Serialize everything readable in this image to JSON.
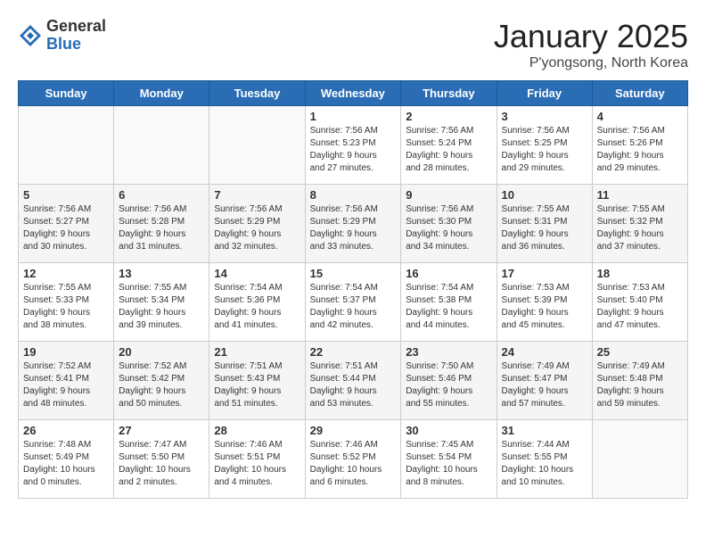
{
  "header": {
    "logo_general": "General",
    "logo_blue": "Blue",
    "month_title": "January 2025",
    "location": "P'yongsong, North Korea"
  },
  "weekdays": [
    "Sunday",
    "Monday",
    "Tuesday",
    "Wednesday",
    "Thursday",
    "Friday",
    "Saturday"
  ],
  "weeks": [
    [
      {
        "day": "",
        "info": ""
      },
      {
        "day": "",
        "info": ""
      },
      {
        "day": "",
        "info": ""
      },
      {
        "day": "1",
        "info": "Sunrise: 7:56 AM\nSunset: 5:23 PM\nDaylight: 9 hours\nand 27 minutes."
      },
      {
        "day": "2",
        "info": "Sunrise: 7:56 AM\nSunset: 5:24 PM\nDaylight: 9 hours\nand 28 minutes."
      },
      {
        "day": "3",
        "info": "Sunrise: 7:56 AM\nSunset: 5:25 PM\nDaylight: 9 hours\nand 29 minutes."
      },
      {
        "day": "4",
        "info": "Sunrise: 7:56 AM\nSunset: 5:26 PM\nDaylight: 9 hours\nand 29 minutes."
      }
    ],
    [
      {
        "day": "5",
        "info": "Sunrise: 7:56 AM\nSunset: 5:27 PM\nDaylight: 9 hours\nand 30 minutes."
      },
      {
        "day": "6",
        "info": "Sunrise: 7:56 AM\nSunset: 5:28 PM\nDaylight: 9 hours\nand 31 minutes."
      },
      {
        "day": "7",
        "info": "Sunrise: 7:56 AM\nSunset: 5:29 PM\nDaylight: 9 hours\nand 32 minutes."
      },
      {
        "day": "8",
        "info": "Sunrise: 7:56 AM\nSunset: 5:29 PM\nDaylight: 9 hours\nand 33 minutes."
      },
      {
        "day": "9",
        "info": "Sunrise: 7:56 AM\nSunset: 5:30 PM\nDaylight: 9 hours\nand 34 minutes."
      },
      {
        "day": "10",
        "info": "Sunrise: 7:55 AM\nSunset: 5:31 PM\nDaylight: 9 hours\nand 36 minutes."
      },
      {
        "day": "11",
        "info": "Sunrise: 7:55 AM\nSunset: 5:32 PM\nDaylight: 9 hours\nand 37 minutes."
      }
    ],
    [
      {
        "day": "12",
        "info": "Sunrise: 7:55 AM\nSunset: 5:33 PM\nDaylight: 9 hours\nand 38 minutes."
      },
      {
        "day": "13",
        "info": "Sunrise: 7:55 AM\nSunset: 5:34 PM\nDaylight: 9 hours\nand 39 minutes."
      },
      {
        "day": "14",
        "info": "Sunrise: 7:54 AM\nSunset: 5:36 PM\nDaylight: 9 hours\nand 41 minutes."
      },
      {
        "day": "15",
        "info": "Sunrise: 7:54 AM\nSunset: 5:37 PM\nDaylight: 9 hours\nand 42 minutes."
      },
      {
        "day": "16",
        "info": "Sunrise: 7:54 AM\nSunset: 5:38 PM\nDaylight: 9 hours\nand 44 minutes."
      },
      {
        "day": "17",
        "info": "Sunrise: 7:53 AM\nSunset: 5:39 PM\nDaylight: 9 hours\nand 45 minutes."
      },
      {
        "day": "18",
        "info": "Sunrise: 7:53 AM\nSunset: 5:40 PM\nDaylight: 9 hours\nand 47 minutes."
      }
    ],
    [
      {
        "day": "19",
        "info": "Sunrise: 7:52 AM\nSunset: 5:41 PM\nDaylight: 9 hours\nand 48 minutes."
      },
      {
        "day": "20",
        "info": "Sunrise: 7:52 AM\nSunset: 5:42 PM\nDaylight: 9 hours\nand 50 minutes."
      },
      {
        "day": "21",
        "info": "Sunrise: 7:51 AM\nSunset: 5:43 PM\nDaylight: 9 hours\nand 51 minutes."
      },
      {
        "day": "22",
        "info": "Sunrise: 7:51 AM\nSunset: 5:44 PM\nDaylight: 9 hours\nand 53 minutes."
      },
      {
        "day": "23",
        "info": "Sunrise: 7:50 AM\nSunset: 5:46 PM\nDaylight: 9 hours\nand 55 minutes."
      },
      {
        "day": "24",
        "info": "Sunrise: 7:49 AM\nSunset: 5:47 PM\nDaylight: 9 hours\nand 57 minutes."
      },
      {
        "day": "25",
        "info": "Sunrise: 7:49 AM\nSunset: 5:48 PM\nDaylight: 9 hours\nand 59 minutes."
      }
    ],
    [
      {
        "day": "26",
        "info": "Sunrise: 7:48 AM\nSunset: 5:49 PM\nDaylight: 10 hours\nand 0 minutes."
      },
      {
        "day": "27",
        "info": "Sunrise: 7:47 AM\nSunset: 5:50 PM\nDaylight: 10 hours\nand 2 minutes."
      },
      {
        "day": "28",
        "info": "Sunrise: 7:46 AM\nSunset: 5:51 PM\nDaylight: 10 hours\nand 4 minutes."
      },
      {
        "day": "29",
        "info": "Sunrise: 7:46 AM\nSunset: 5:52 PM\nDaylight: 10 hours\nand 6 minutes."
      },
      {
        "day": "30",
        "info": "Sunrise: 7:45 AM\nSunset: 5:54 PM\nDaylight: 10 hours\nand 8 minutes."
      },
      {
        "day": "31",
        "info": "Sunrise: 7:44 AM\nSunset: 5:55 PM\nDaylight: 10 hours\nand 10 minutes."
      },
      {
        "day": "",
        "info": ""
      }
    ]
  ]
}
